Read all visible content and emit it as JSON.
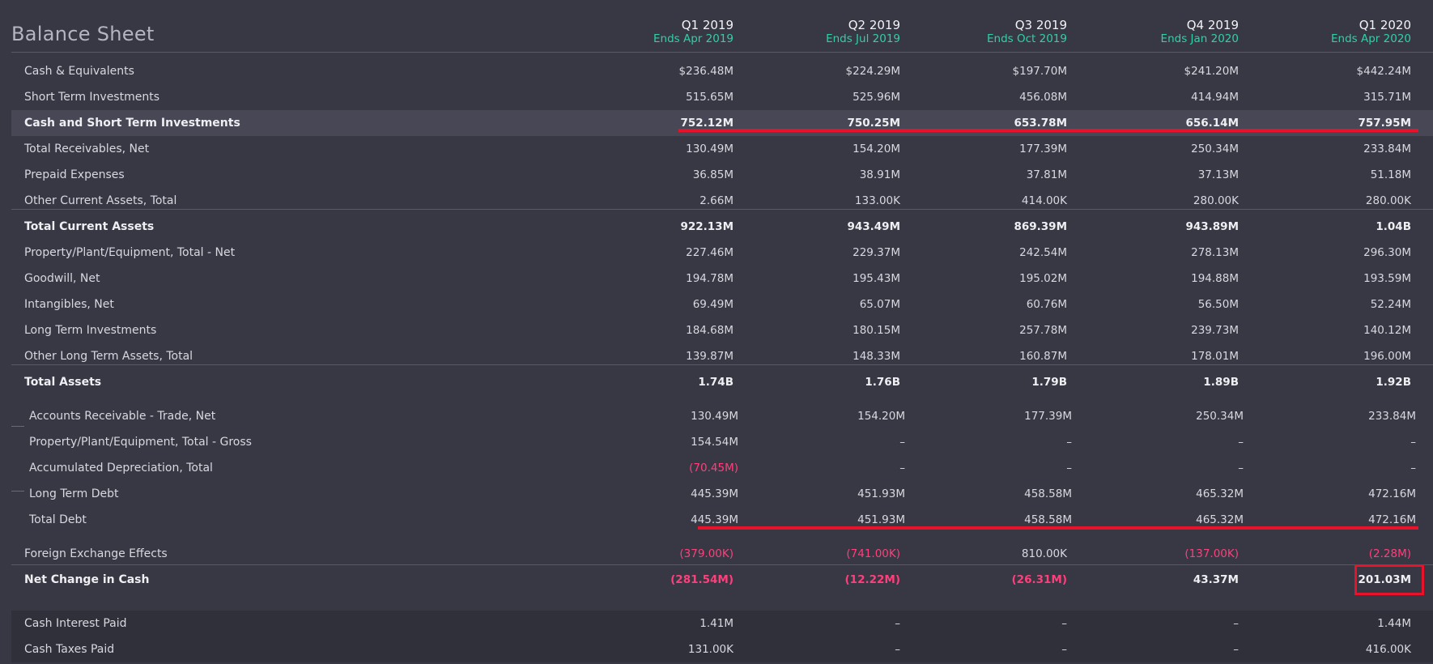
{
  "title": "Balance Sheet",
  "periods": [
    {
      "quarter": "Q1 2019",
      "ends": "Ends Apr 2019"
    },
    {
      "quarter": "Q2 2019",
      "ends": "Ends Jul 2019"
    },
    {
      "quarter": "Q3 2019",
      "ends": "Ends Oct 2019"
    },
    {
      "quarter": "Q4 2019",
      "ends": "Ends Jan 2020"
    },
    {
      "quarter": "Q1 2020",
      "ends": "Ends Apr 2020"
    }
  ],
  "colors": {
    "background": "#383844",
    "accent": "#2fd0a8",
    "negative": "#ff3f7c",
    "annotation": "#e8122a"
  },
  "rows": [
    {
      "label": "Cash & Equivalents",
      "values": [
        "$236.48M",
        "$224.29M",
        "$197.70M",
        "$241.20M",
        "$442.24M"
      ]
    },
    {
      "label": "Short Term Investments",
      "values": [
        "515.65M",
        "525.96M",
        "456.08M",
        "414.94M",
        "315.71M"
      ]
    },
    {
      "label": "Cash and Short Term Investments",
      "values": [
        "752.12M",
        "750.25M",
        "653.78M",
        "656.14M",
        "757.95M"
      ]
    },
    {
      "label": "Total Receivables, Net",
      "values": [
        "130.49M",
        "154.20M",
        "177.39M",
        "250.34M",
        "233.84M"
      ]
    },
    {
      "label": "Prepaid Expenses",
      "values": [
        "36.85M",
        "38.91M",
        "37.81M",
        "37.13M",
        "51.18M"
      ]
    },
    {
      "label": "Other Current Assets, Total",
      "values": [
        "2.66M",
        "133.00K",
        "414.00K",
        "280.00K",
        "280.00K"
      ]
    },
    {
      "label": "Total Current Assets",
      "values": [
        "922.13M",
        "943.49M",
        "869.39M",
        "943.89M",
        "1.04B"
      ]
    },
    {
      "label": "Property/Plant/Equipment, Total - Net",
      "values": [
        "227.46M",
        "229.37M",
        "242.54M",
        "278.13M",
        "296.30M"
      ]
    },
    {
      "label": "Goodwill, Net",
      "values": [
        "194.78M",
        "195.43M",
        "195.02M",
        "194.88M",
        "193.59M"
      ]
    },
    {
      "label": "Intangibles, Net",
      "values": [
        "69.49M",
        "65.07M",
        "60.76M",
        "56.50M",
        "52.24M"
      ]
    },
    {
      "label": "Long Term Investments",
      "values": [
        "184.68M",
        "180.15M",
        "257.78M",
        "239.73M",
        "140.12M"
      ]
    },
    {
      "label": "Other Long Term Assets, Total",
      "values": [
        "139.87M",
        "148.33M",
        "160.87M",
        "178.01M",
        "196.00M"
      ]
    },
    {
      "label": "Total Assets",
      "values": [
        "1.74B",
        "1.76B",
        "1.79B",
        "1.89B",
        "1.92B"
      ]
    },
    {
      "label": "Accounts Receivable - Trade, Net",
      "values": [
        "130.49M",
        "154.20M",
        "177.39M",
        "250.34M",
        "233.84M"
      ]
    },
    {
      "label": "Property/Plant/Equipment, Total - Gross",
      "values": [
        "154.54M",
        "–",
        "–",
        "–",
        "–"
      ]
    },
    {
      "label": "Accumulated Depreciation, Total",
      "values": [
        "(70.45M)",
        "–",
        "–",
        "–",
        "–"
      ]
    },
    {
      "label": "Long Term Debt",
      "values": [
        "445.39M",
        "451.93M",
        "458.58M",
        "465.32M",
        "472.16M"
      ]
    },
    {
      "label": "Total Debt",
      "values": [
        "445.39M",
        "451.93M",
        "458.58M",
        "465.32M",
        "472.16M"
      ]
    },
    {
      "label": "Foreign Exchange Effects",
      "values": [
        "(379.00K)",
        "(741.00K)",
        "810.00K",
        "(137.00K)",
        "(2.28M)"
      ]
    },
    {
      "label": "Net Change in Cash",
      "values": [
        "(281.54M)",
        "(12.22M)",
        "(26.31M)",
        "43.37M",
        "201.03M"
      ]
    },
    {
      "label": "Cash Interest Paid",
      "values": [
        "1.41M",
        "–",
        "–",
        "–",
        "1.44M"
      ]
    },
    {
      "label": "Cash Taxes Paid",
      "values": [
        "131.00K",
        "–",
        "–",
        "–",
        "416.00K"
      ]
    }
  ]
}
